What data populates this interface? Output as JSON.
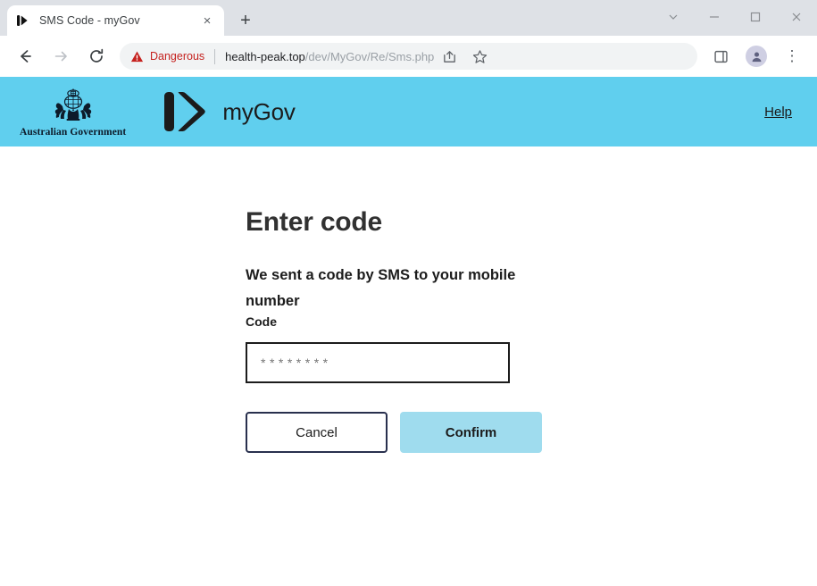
{
  "browser": {
    "tab": {
      "title": "SMS Code - myGov",
      "favicon_name": "mygov-chevron-favicon",
      "close_label": "×"
    },
    "new_tab_label": "+",
    "window_controls": [
      {
        "name": "tab-search-button",
        "label": "⌄"
      },
      {
        "name": "minimize-button",
        "label": "–"
      },
      {
        "name": "maximize-button",
        "label": "□"
      },
      {
        "name": "close-window-button",
        "label": "×"
      }
    ],
    "nav": {
      "back_name": "back-button",
      "forward_name": "forward-button",
      "reload_name": "reload-button"
    },
    "omnibox": {
      "security_badge": "Dangerous",
      "url_domain": "health-peak.top",
      "url_path": "/dev/MyGov/Re/Sms.php",
      "share_name": "share-icon",
      "bookmark_name": "bookmark-star-icon"
    },
    "toolbar_icons": {
      "side_panel_name": "side-panel-icon",
      "profile_name": "profile-avatar",
      "menu_label": "⋮"
    }
  },
  "page": {
    "banner": {
      "crest_text": "Australian Government",
      "logo_word": "myGov",
      "help_label": "Help",
      "background_color": "#60cfee"
    },
    "main": {
      "title": "Enter code",
      "subtitle": "We sent a code by SMS to your mobile number",
      "code_label": "Code",
      "code_value": "",
      "code_placeholder": "********",
      "cancel_label": "Cancel",
      "confirm_label": "Confirm",
      "confirm_color": "#9fdcee"
    }
  }
}
